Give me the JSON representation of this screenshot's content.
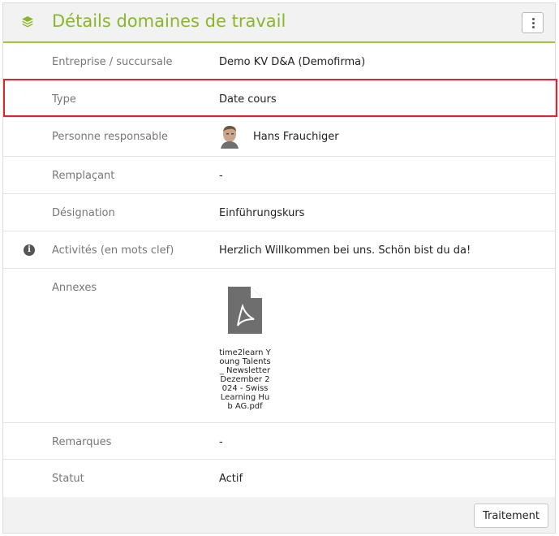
{
  "header": {
    "title": "Détails domaines de travail",
    "icon": "stack-icon",
    "menu_icon": "vertical-dots-icon"
  },
  "accent_color": "#8bb62c",
  "rows": [
    {
      "label": "Entreprise / succursale",
      "value": "Demo KV D&A (Demofirma)"
    },
    {
      "label": "Type",
      "value": "Date cours"
    },
    {
      "label": "Personne responsable",
      "value": "Hans Frauchiger"
    },
    {
      "label": "Remplaçant",
      "value": "-"
    },
    {
      "label": "Désignation",
      "value": "Einführungskurs"
    },
    {
      "label": "Activités (en mots clef)",
      "value": "Herzlich Willkommen bei uns. Schön bist du da!"
    },
    {
      "label": "Annexes",
      "file_name": "time2learn Young Talents _ Newsletter Dezember 2024 - Swiss Learning Hub AG.pdf",
      "file_icon": "pdf-file-icon"
    },
    {
      "label": "Remarques",
      "value": "-"
    },
    {
      "label": "Statut",
      "value": "Actif"
    }
  ],
  "footer": {
    "button_label": "Traitement"
  }
}
